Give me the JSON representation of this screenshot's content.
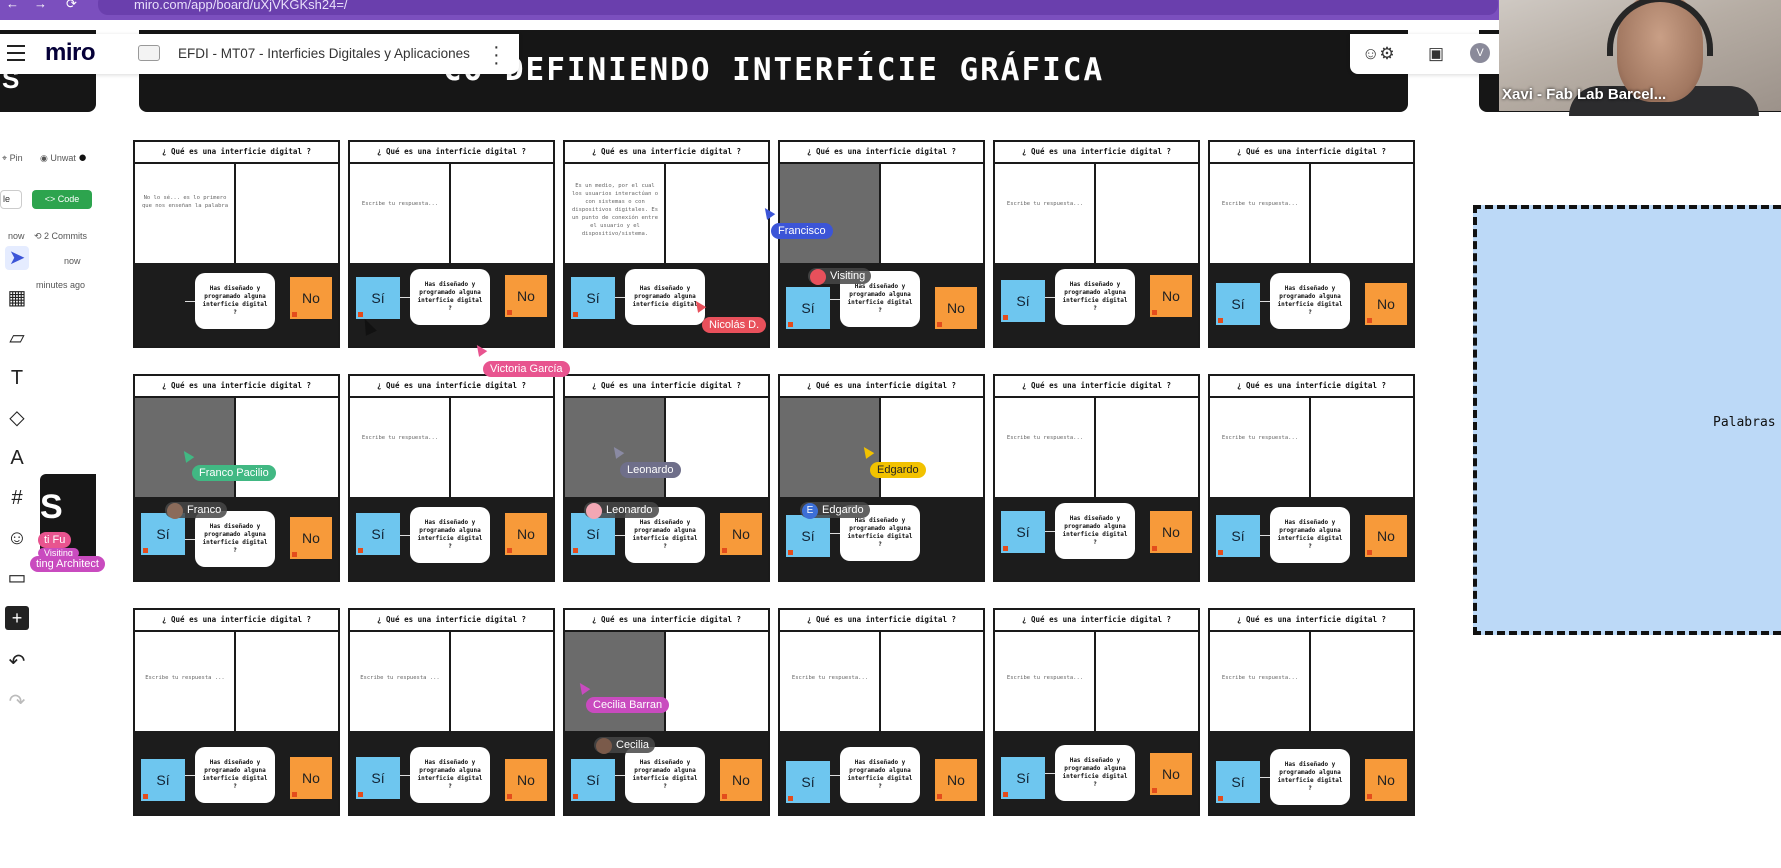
{
  "browser": {
    "url": "miro.com/app/board/uXjVKGKsh24=/",
    "nav": [
      "←",
      "→",
      "⟳"
    ]
  },
  "miro": {
    "logo": "miro",
    "board_name": "EFDI - MT07 - Interficies Digitales y Aplicaciones"
  },
  "board": {
    "title": "CO-DEFINIENDO INTERFÍCIE GRÁFICA",
    "left_title_fragment": "S",
    "left_card_letter": "S"
  },
  "right_tools": {
    "avatar_letter": "V"
  },
  "webcam": {
    "name": "Xavi - Fab Lab Barcel..."
  },
  "left_panel": {
    "pin": "Pin",
    "unwatch": "Unwat",
    "code_label": "<> Code",
    "select_value": "le",
    "now": "now",
    "commits": "2 Commits",
    "now2": "now",
    "minutes_ago": "minutes ago"
  },
  "left_pills": {
    "a": "ti Fu",
    "b": "ting Architect",
    "c": "Visiting"
  },
  "frames": [
    {
      "question": "¿ Qué es una interficie digital ?",
      "answer": "No lo sé... es lo primero que nos enseñan la palabra",
      "q": "Has diseñado y programado alguna interficie digital ?",
      "si": "",
      "no": "No",
      "grey": false
    },
    {
      "question": "¿ Qué es una interficie digital ?",
      "answer": "Escribe tu respuesta...",
      "q": "Has diseñado y programado alguna interficie digital ?",
      "si": "Sí",
      "no": "No",
      "grey": false
    },
    {
      "question": "¿ Qué es una interficie digital ?",
      "answer": "Es un medio, por el cual los usuarios interactúan o con sistemas o con dispositivos digitales. Es un punto de conexión entre el usuario y el dispositivo/sistema.",
      "q": "Has diseñado y programado alguna interficie digital",
      "si": "Sí",
      "no": "",
      "grey": false
    },
    {
      "question": "¿ Qué es una interficie digital ?",
      "answer": "",
      "q": "Has diseñado y programado alguna interficie digital ?",
      "si": "Sí",
      "no": "No",
      "grey": true
    },
    {
      "question": "¿ Qué es una interficie digital ?",
      "answer": "Escribe tu respuesta...",
      "q": "Has diseñado y programado alguna interficie digital ?",
      "si": "Sí",
      "no": "No",
      "grey": false
    },
    {
      "question": "¿ Qué es una interficie digital ?",
      "answer": "Escribe tu respuesta...",
      "q": "Has diseñado y programado alguna interficie digital ?",
      "si": "Sí",
      "no": "No",
      "grey": false
    },
    {
      "question": "¿ Qué es una interficie digital ?",
      "answer": "",
      "q": "Has diseñado y programado alguna interficie digital ?",
      "si": "Sí",
      "no": "No",
      "grey": true
    },
    {
      "question": "¿ Qué es una interficie digital ?",
      "answer": "Escribe tu respuesta...",
      "q": "Has diseñado y programado alguna interficie digital ?",
      "si": "Sí",
      "no": "No",
      "grey": false
    },
    {
      "question": "¿ Qué es una interficie digital ?",
      "answer": "",
      "q": "Has diseñado y programado alguna interficie digital ?",
      "si": "Sí",
      "no": "No",
      "grey": true
    },
    {
      "question": "¿ Qué es una interficie digital ?",
      "answer": "",
      "q": "Has diseñado y programado alguna interficie digital ?",
      "si": "Sí",
      "no": "",
      "grey": true
    },
    {
      "question": "¿ Qué es una interficie digital ?",
      "answer": "Escribe tu respuesta...",
      "q": "Has diseñado y programado alguna interficie digital ?",
      "si": "Sí",
      "no": "No",
      "grey": false
    },
    {
      "question": "¿ Qué es una interficie digital ?",
      "answer": "Escribe tu respuesta...",
      "q": "Has diseñado y programado alguna interficie digital ?",
      "si": "Sí",
      "no": "No",
      "grey": false
    },
    {
      "question": "¿ Qué es una interficie digital ?",
      "answer": "Escribe tu respuesta ...",
      "q": "Has diseñado y programado alguna interficie digital ?",
      "si": "Sí",
      "no": "No",
      "grey": false
    },
    {
      "question": "¿ Qué es una interficie digital ?",
      "answer": "Escribe tu respuesta ...",
      "q": "Has diseñado y programado alguna interficie digital ?",
      "si": "Sí",
      "no": "No",
      "grey": false
    },
    {
      "question": "¿ Qué es una interficie digital ?",
      "answer": "",
      "q": "Has diseñado y programado alguna interficie digital ?",
      "si": "Sí",
      "no": "No",
      "grey": true
    },
    {
      "question": "¿ Qué es una interficie digital ?",
      "answer": "Escribe tu respuesta...",
      "q": "Has diseñado y programado alguna interficie digital ?",
      "si": "Sí",
      "no": "No",
      "grey": false
    },
    {
      "question": "¿ Qué es una interficie digital ?",
      "answer": "Escribe tu respuesta...",
      "q": "Has diseñado y programado alguna interficie digital ?",
      "si": "Sí",
      "no": "No",
      "grey": false
    },
    {
      "question": "¿ Qué es una interficie digital ?",
      "answer": "Escribe tu respuesta...",
      "q": "Has diseñado y programado alguna interficie digital ?",
      "si": "Sí",
      "no": "No",
      "grey": false
    }
  ],
  "cursors": {
    "francisco": "Francisco",
    "visiting": "Visiting",
    "nicolas": "Nicolás D.",
    "victoria": "Victoria García",
    "franco_pacilio": "Franco Pacilio",
    "franco": "Franco",
    "leonardo_cursor": "Leonardo",
    "leonardo_chip": "Leonardo",
    "edgardo_cursor": "Edgardo",
    "edgardo_chip": "Edgardo",
    "edgardo_initial": "E",
    "cecilia_barran": "Cecilia Barran",
    "cecilia": "Cecilia"
  },
  "blue_frame": {
    "label": "Palabras"
  },
  "colors": {
    "browser_bar": "#7b4fbe",
    "sticky_si": "#6ec6ef",
    "sticky_no": "#f79a3a",
    "frame_dark": "#1c1c1c",
    "blue_frame": "#bcd9f7"
  },
  "icons": [
    "menu-icon",
    "board-icon",
    "kebab-icon",
    "reactions-icon",
    "present-icon",
    "select-tool-icon",
    "template-icon",
    "sticky-note-icon",
    "text-icon",
    "shapes-icon",
    "pen-icon",
    "frame-icon",
    "emoji-icon",
    "comment-icon",
    "add-icon",
    "undo-icon",
    "redo-icon"
  ]
}
